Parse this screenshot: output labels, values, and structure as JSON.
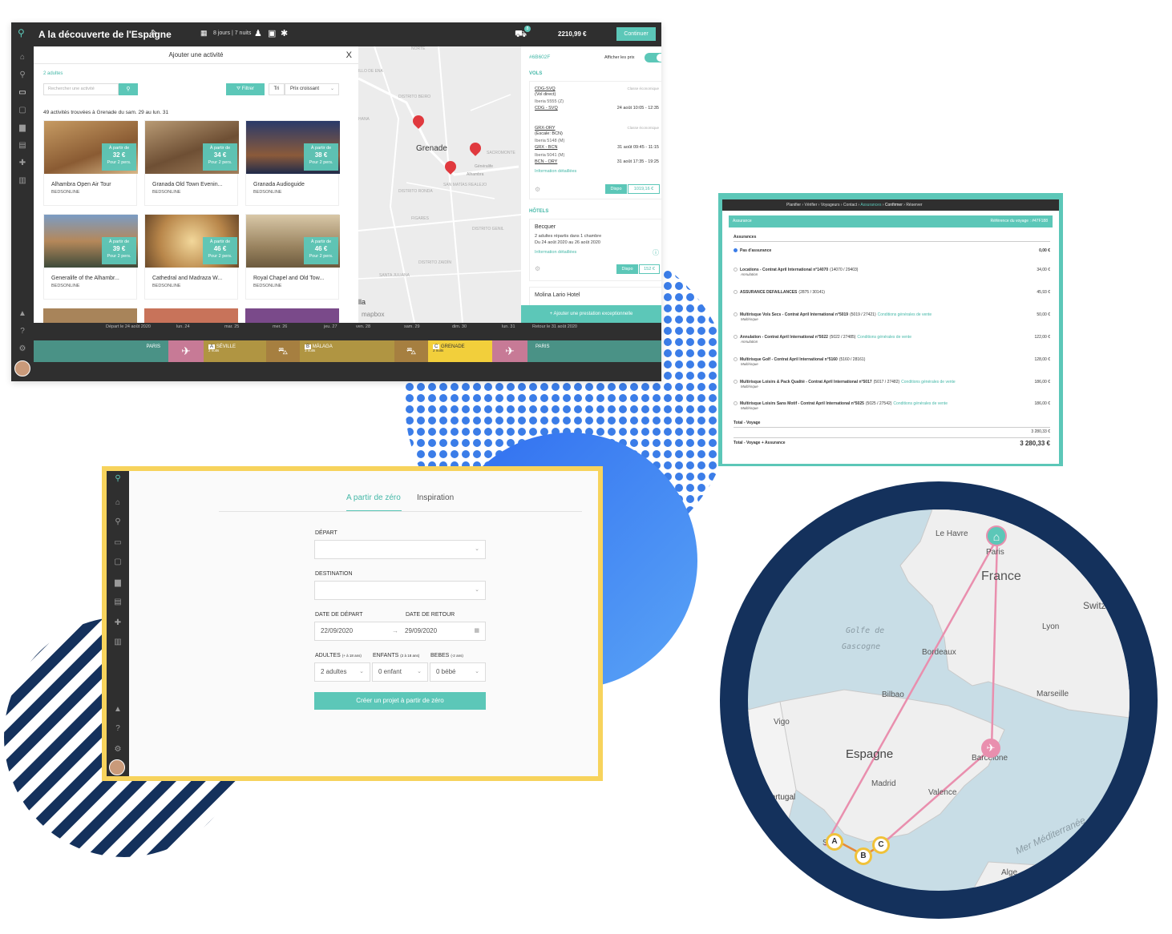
{
  "screen1": {
    "trip_title": "A la découverte de l'Espagne",
    "trip_duration": "8 jours | 7 nuits",
    "cart_badge": "8",
    "total_price": "2210,99 €",
    "continue_label": "Continuer",
    "panel_title": "Ajouter une activité",
    "close": "X",
    "adults": "2 adultes",
    "search_placeholder": "Rechercher une activité",
    "filter_label": "Filtrer",
    "sort_label": "Tri",
    "sort_value": "Prix croissant",
    "results_text": "49 activités trouvées à Grenade du sam. 29 au lun. 31",
    "price_prefix": "À partir de",
    "price_suffix": "Pour 2 pers.",
    "activities": [
      {
        "name": "Alhambra Open Air Tour",
        "supplier": "BEDSONLINE",
        "price": "32 €"
      },
      {
        "name": "Granada Old Town Evenin...",
        "supplier": "BEDSONLINE",
        "price": "34 €"
      },
      {
        "name": "Granada Audioguide",
        "supplier": "BEDSONLINE",
        "price": "38 €"
      },
      {
        "name": "Generalife of the Alhambr...",
        "supplier": "BEDSONLINE",
        "price": "39 €"
      },
      {
        "name": "Cathedral and Madraza W...",
        "supplier": "BEDSONLINE",
        "price": "46 €"
      },
      {
        "name": "Royal Chapel and Old Tow...",
        "supplier": "BEDSONLINE",
        "price": "46 €"
      }
    ],
    "map": {
      "city": "Grenade",
      "labels": [
        "NORTE",
        "DISTRITO BEIRO",
        "SACROMONTE",
        "Alhambra",
        "Généralife",
        "SAN MATÍAS REALEJO",
        "DISTRITO RONDA",
        "FIGARES",
        "DISTRITO GENIL",
        "DISTRITO ZAIDÍN",
        "SANTA JULIANA",
        "HANA",
        "ILLO DE ENA"
      ],
      "attribution": "mapbox",
      "partial": "lla"
    },
    "right": {
      "ref": "#6B602F",
      "show_prices": "Afficher les prix",
      "flights_title": "VOLS",
      "economy": "Classe économique",
      "flight1": {
        "route": "CDG-SVQ",
        "note": "(Vol direct)",
        "airline": "Iberia 5555 (Z)",
        "leg": "CDG - SVQ",
        "time": "24 août 10:05 - 12:35"
      },
      "flight2": {
        "route": "GRX-ORY",
        "note": "(Escale: BCN)",
        "airline1": "Iberia 5148 (M)",
        "leg1": "GRX - BCN",
        "time1": "31 août 09:45 - 11:15",
        "airline2": "Iberia 5041 (M)",
        "leg2": "BCN - ORY",
        "time2": "31 août 17:35 - 19:25"
      },
      "details": "Information détaillées",
      "dispo": "Dispo",
      "flight_price": "1019,16 €",
      "hotels_title": "HÔTELS",
      "hotel1": {
        "name": "Becquer",
        "rooms": "2 adultes répartis dans 1 chambre",
        "dates": "Du 24 août 2020 au 26 août 2020",
        "price": "152 €"
      },
      "hotel2": {
        "name": "Molina Lario Hotel"
      },
      "add_service": "+ Ajouter une prestation exceptionnelle"
    },
    "timeline": {
      "dates": [
        "Départ le 24 août 2020",
        "lun. 24",
        "mar. 25",
        "mer. 26",
        "jeu. 27",
        "ven. 28",
        "sam. 29",
        "dim. 30",
        "lun. 31",
        "Retour le 31 août 2020"
      ],
      "paris": "PARIS",
      "stops": [
        {
          "letter": "A",
          "city": "SÉVILLE",
          "nights": "2 nuits"
        },
        {
          "letter": "B",
          "city": "MÁLAGA",
          "nights": "3 nuits"
        },
        {
          "letter": "C",
          "city": "GRENADE",
          "nights": "2 nuits"
        }
      ]
    }
  },
  "screen2": {
    "steps": [
      "Planifier",
      "Vérifier",
      "Voyageurs",
      "Contact",
      "Assurances",
      "Confirmer",
      "Réserver"
    ],
    "header_title": "Assurance",
    "header_ref": "Référence du voyage : #47F188",
    "section": "Assurances",
    "none_label": "Pas d'assurance",
    "none_amount": "0,00 €",
    "conditions": "Conditions générales de vente",
    "options": [
      {
        "name": "Locations - Contrat April International n°14070",
        "code": "(14070 / 29403)",
        "sub": "Annulation",
        "amount": "34,00 €",
        "cond": false
      },
      {
        "name": "ASSURANCE DEFAILLANCES",
        "code": "(2875 / 30141)",
        "sub": "",
        "amount": "45,93 €",
        "cond": false
      },
      {
        "name": "Multirisque Vols Secs - Contrat April International n°5019",
        "code": "(5019 / 27421)",
        "sub": "Multirisque",
        "amount": "50,00 €",
        "cond": true
      },
      {
        "name": "Annulation - Contrat April International n°5022",
        "code": "(5022 / 27485)",
        "sub": "Annulation",
        "amount": "122,00 €",
        "cond": true
      },
      {
        "name": "Multirisque Golf - Contrat April International n°5160",
        "code": "(5160 / 28161)",
        "sub": "Multirisque",
        "amount": "128,00 €",
        "cond": false
      },
      {
        "name": "Multirisque Loisirs & Pack Qualité - Contrat April International n°5017",
        "code": "(5017 / 27482)",
        "sub": "Multirisque",
        "amount": "186,00 €",
        "cond": true
      },
      {
        "name": "Multirisque Loisirs Sans Motif - Contrat April International n°5025",
        "code": "(5025 / 27542)",
        "sub": "Multirisque",
        "amount": "186,00 €",
        "cond": true
      }
    ],
    "total_trip_label": "Total - Voyage",
    "total_trip": "3 280,33 €",
    "total_all_label": "Total - Voyage + Assurance",
    "total_all": "3 280,33 €"
  },
  "screen3": {
    "tab_scratch": "A partir de zéro",
    "tab_inspiration": "Inspiration",
    "depart_label": "DÉPART",
    "destination_label": "DESTINATION",
    "date_depart_label": "DATE DE DÉPART",
    "date_return_label": "DATE DE RETOUR",
    "date_depart": "22/09/2020",
    "date_return": "29/09/2020",
    "adults_label": "ADULTES",
    "adults_hint": "(+ à 18 ans)",
    "children_label": "ENFANTS",
    "children_hint": "(2 à 18 ans)",
    "babies_label": "BEBES",
    "babies_hint": "(-2 ans)",
    "adults_value": "2 adultes",
    "children_value": "0 enfant",
    "babies_value": "0 bébé",
    "create_label": "Créer un projet à partir de zéro"
  },
  "screen4": {
    "labels": [
      "Le Havre",
      "Paris",
      "France",
      "Switz",
      "Lyon",
      "Golfe de",
      "Gascogne",
      "Bordeaux",
      "Bilbao",
      "Marseille",
      "Vigo",
      "Espagne",
      "Barcelone",
      "Madrid",
      "Portugal",
      "Valence",
      "Mer Méditerranée",
      "Alge",
      "S"
    ],
    "markers": [
      "A",
      "B",
      "C"
    ]
  },
  "colors": {
    "teal": "#5cc7b8",
    "dark": "#2f2f2f",
    "navy": "#14315c",
    "yellow": "#f7d35c",
    "blue": "#4f8ef7",
    "pink": "#e98fae"
  }
}
